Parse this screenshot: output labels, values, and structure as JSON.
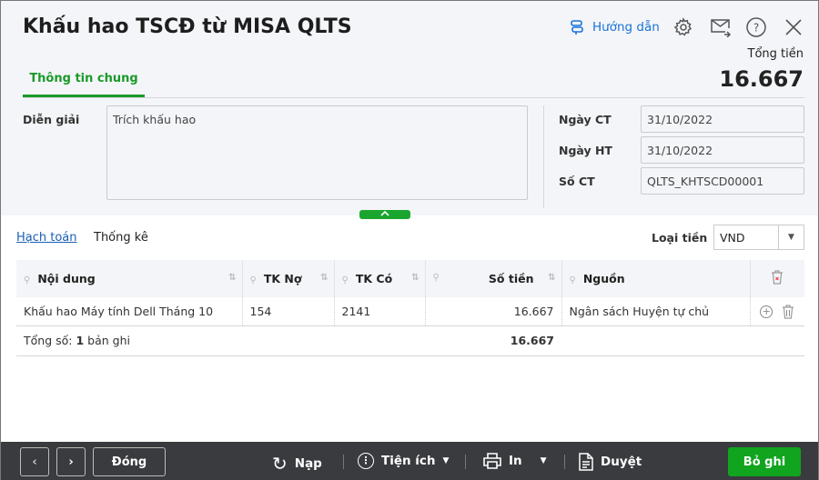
{
  "title": "Khấu hao TSCĐ từ MISA QLTS",
  "header": {
    "guide": "Hướng dẫn",
    "total_label": "Tổng tiền",
    "total": "16.667"
  },
  "tabs": [
    "Thông tin chung"
  ],
  "form": {
    "desc_label": "Diễn giải",
    "desc_value": "Trích khấu hao",
    "date_ct_label": "Ngày CT",
    "date_ct": "31/10/2022",
    "date_ht_label": "Ngày HT",
    "date_ht": "31/10/2022",
    "so_ct_label": "Số CT",
    "so_ct": "QLTS_KHTSCD00001"
  },
  "subtabs": {
    "accounting": "Hạch toán",
    "stats": "Thống kê"
  },
  "currency": {
    "label": "Loại tiền",
    "value": "VND"
  },
  "table": {
    "headers": [
      "Nội dung",
      "TK Nợ",
      "TK Có",
      "Số tiền",
      "Nguồn"
    ],
    "rows": [
      [
        "Khấu hao Máy tính Dell Tháng 10",
        "154",
        "2141",
        "16.667",
        "Ngân sách Huyện tự chủ"
      ]
    ],
    "footer_prefix": "Tổng số: ",
    "footer_count": "1",
    "footer_suffix": " bản ghi",
    "footer_total": "16.667"
  },
  "toolbar": {
    "close": "Đóng",
    "reload": "Nạp",
    "utilities": "Tiện ích",
    "print": "In",
    "approve": "Duyệt",
    "save": "Bỏ ghi"
  }
}
